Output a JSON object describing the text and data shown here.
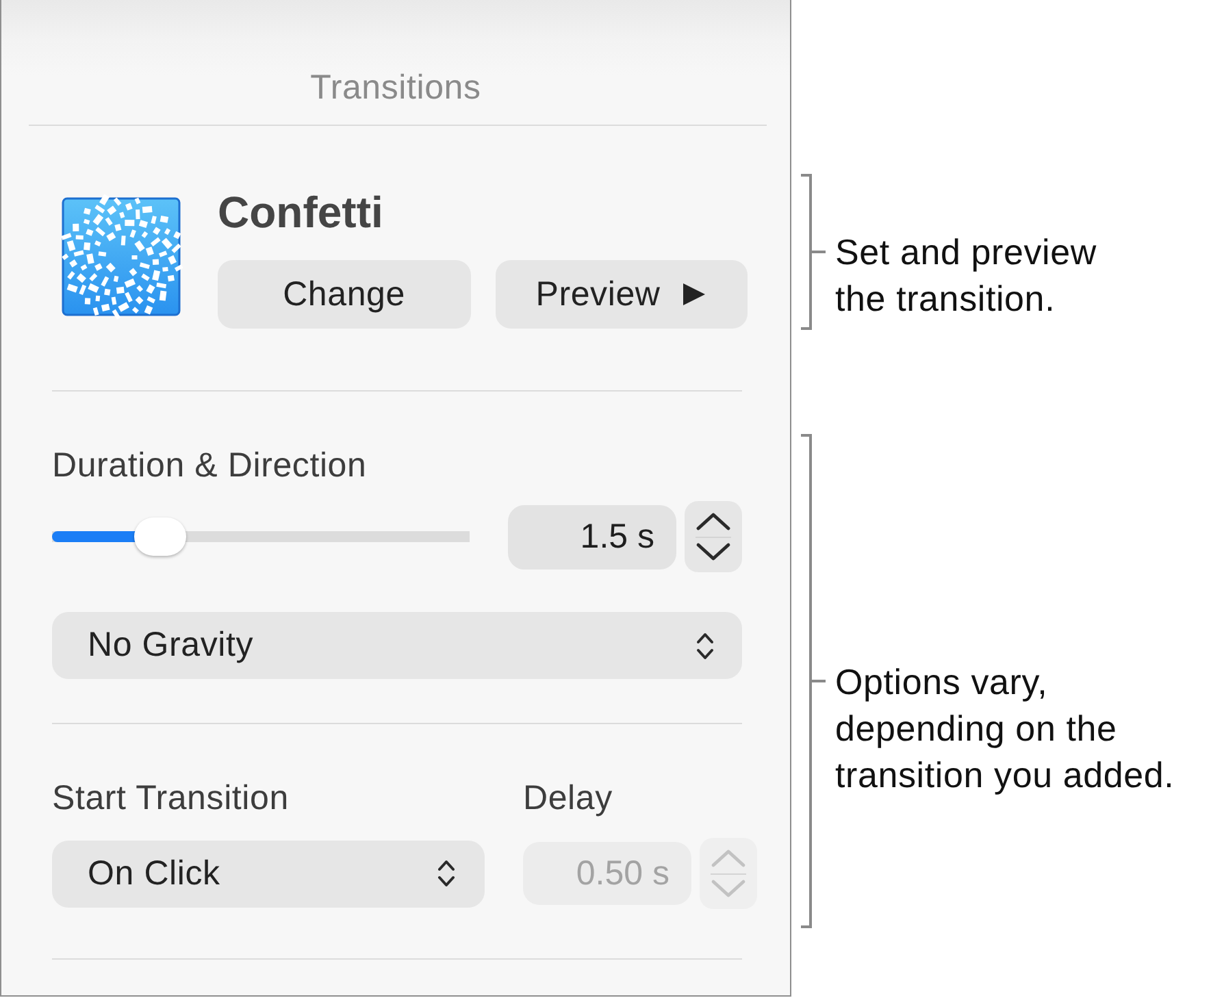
{
  "panel": {
    "title": "Transitions"
  },
  "transition": {
    "name": "Confetti",
    "buttons": [
      {
        "label": "Change",
        "kind": "plain"
      },
      {
        "label": "Preview",
        "kind": "play"
      }
    ]
  },
  "duration": {
    "label": "Duration & Direction",
    "level": 0.26,
    "value": "1.5 s",
    "disabled": false
  },
  "direction": {
    "value": "No Gravity"
  },
  "start_transition": {
    "label": "Start Transition",
    "value": "On Click"
  },
  "delay": {
    "label": "Delay",
    "value": "0.50 s",
    "disabled": true
  },
  "callouts": [
    {
      "text": "Set and preview\nthe transition."
    },
    {
      "text": "Options vary,\ndepending on the\ntransition you added."
    }
  ]
}
